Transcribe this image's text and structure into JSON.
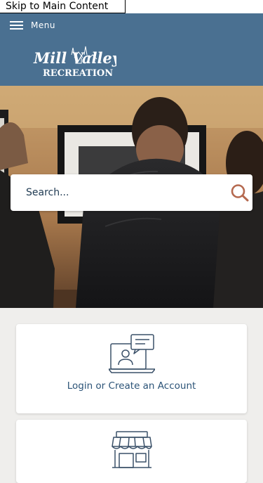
{
  "skip_link": "Skip to Main Content",
  "header": {
    "menu_label": "Menu",
    "background_color": "#4a7091",
    "logo": {
      "line1": "Mill Valley",
      "line2": "RECREATION"
    }
  },
  "search": {
    "placeholder": "Search...",
    "icon": "search-icon",
    "icon_color": "#b5694f"
  },
  "cards": [
    {
      "label": "Login or Create an Account",
      "icon": "computer-chat-icon"
    },
    {
      "label": "",
      "icon": "storefront-icon"
    }
  ],
  "colors": {
    "accent_text": "#2b5377",
    "page_background": "#efeeec"
  }
}
